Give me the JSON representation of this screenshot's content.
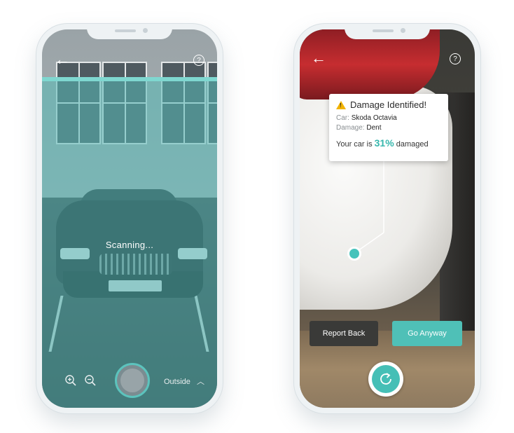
{
  "left_phone": {
    "status_text": "Scanning...",
    "back_icon": "back-arrow-icon",
    "help_icon": "help-circle-icon",
    "zoom_in_icon": "zoom-in-icon",
    "zoom_out_icon": "zoom-out-icon",
    "mode_label": "Outside",
    "mode_chevron_icon": "chevron-up-icon"
  },
  "right_phone": {
    "back_icon": "back-arrow-icon",
    "help_icon": "help-circle-icon",
    "card": {
      "title": "Damage Identified!",
      "warning_icon": "warning-triangle-icon",
      "car_label": "Car:",
      "car_value": "Skoda Octavia",
      "damage_label": "Damage:",
      "damage_value": "Dent",
      "summary_prefix": "Your car is",
      "summary_percent": "31%",
      "summary_suffix": "damaged"
    },
    "report_button": "Report Back",
    "go_button": "Go Anyway",
    "retake_icon": "retake-icon"
  },
  "colors": {
    "accent": "#4fc0b7",
    "warning": "#f2b300",
    "dark_button": "#3a3a38"
  }
}
